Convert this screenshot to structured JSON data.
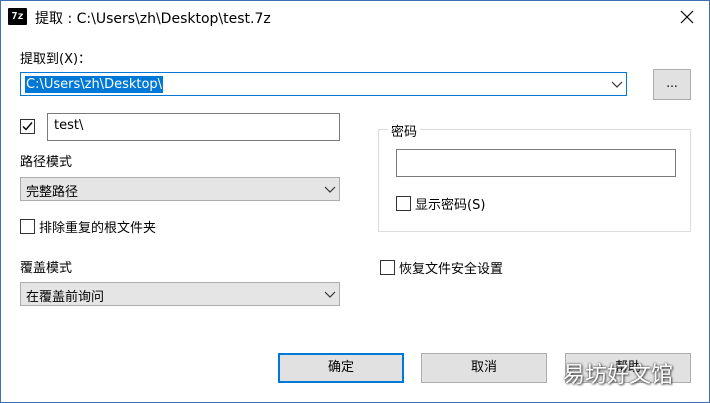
{
  "window": {
    "title": "提取 : C:\\Users\\zh\\Desktop\\test.7z",
    "app_icon": "7z"
  },
  "extract_to": {
    "label": "提取到(X)：",
    "value": "C:\\Users\\zh\\Desktop\\",
    "browse_label": "..."
  },
  "subfolder": {
    "checked": true,
    "value": "test\\"
  },
  "path_mode": {
    "label": "路径模式",
    "selected": "完整路径"
  },
  "eliminate_root": {
    "label": "排除重复的根文件夹",
    "checked": false
  },
  "overwrite_mode": {
    "label": "覆盖模式",
    "selected": "在覆盖前询问"
  },
  "password": {
    "group_label": "密码",
    "value": "",
    "show_label": "显示密码(S)",
    "show_checked": false
  },
  "restore_security": {
    "label": "恢复文件安全设置",
    "checked": false
  },
  "buttons": {
    "ok": "确定",
    "cancel": "取消",
    "help": "帮助"
  },
  "watermark": "易坊好文馆",
  "colors": {
    "accent": "#0078d7",
    "button_face": "#e1e1e1",
    "select_face": "#e5e5e5"
  }
}
